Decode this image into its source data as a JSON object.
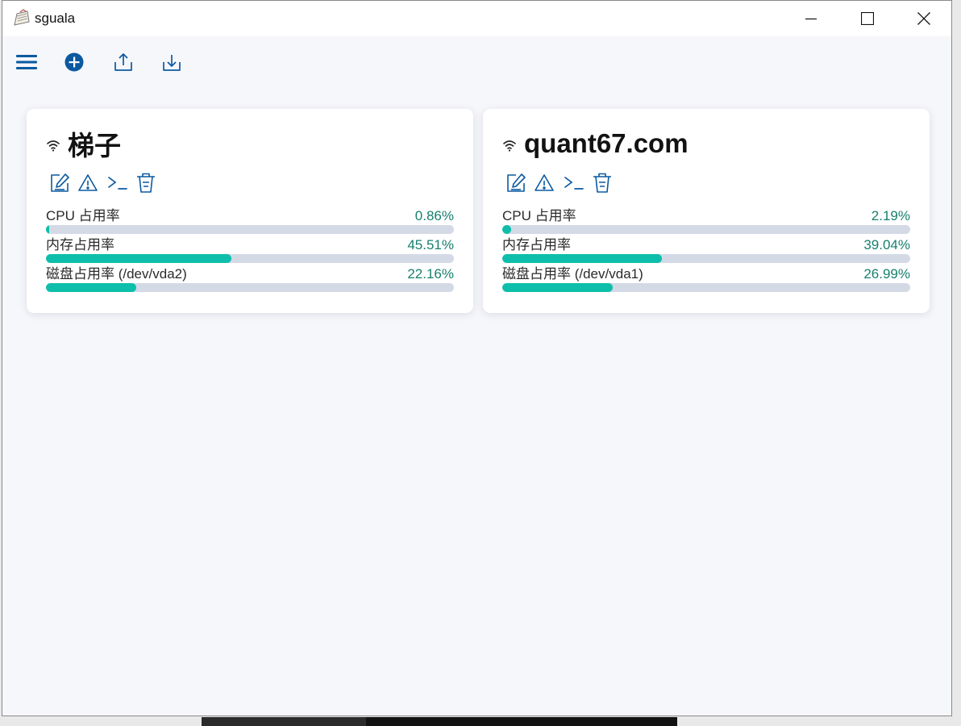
{
  "window": {
    "title": "sguala"
  },
  "toolbar": {
    "items": [
      {
        "icon": "menu-icon"
      },
      {
        "icon": "add-circle-icon"
      },
      {
        "icon": "upload-icon"
      },
      {
        "icon": "download-icon"
      }
    ]
  },
  "colors": {
    "accent": "#0b5aa0",
    "bar_fill": "#0dbfaa",
    "bar_track": "#d4d9e6",
    "value_text": "#17806e"
  },
  "servers": [
    {
      "name": "梯子",
      "metrics": [
        {
          "label": "CPU 占用率",
          "value": "0.86%",
          "percent": 0.86
        },
        {
          "label": "内存占用率",
          "value": "45.51%",
          "percent": 45.51
        },
        {
          "label": "磁盘占用率 (/dev/vda2)",
          "value": "22.16%",
          "percent": 22.16
        }
      ]
    },
    {
      "name": "quant67.com",
      "metrics": [
        {
          "label": "CPU 占用率",
          "value": "2.19%",
          "percent": 2.19
        },
        {
          "label": "内存占用率",
          "value": "39.04%",
          "percent": 39.04
        },
        {
          "label": "磁盘占用率 (/dev/vda1)",
          "value": "26.99%",
          "percent": 26.99
        }
      ]
    }
  ]
}
